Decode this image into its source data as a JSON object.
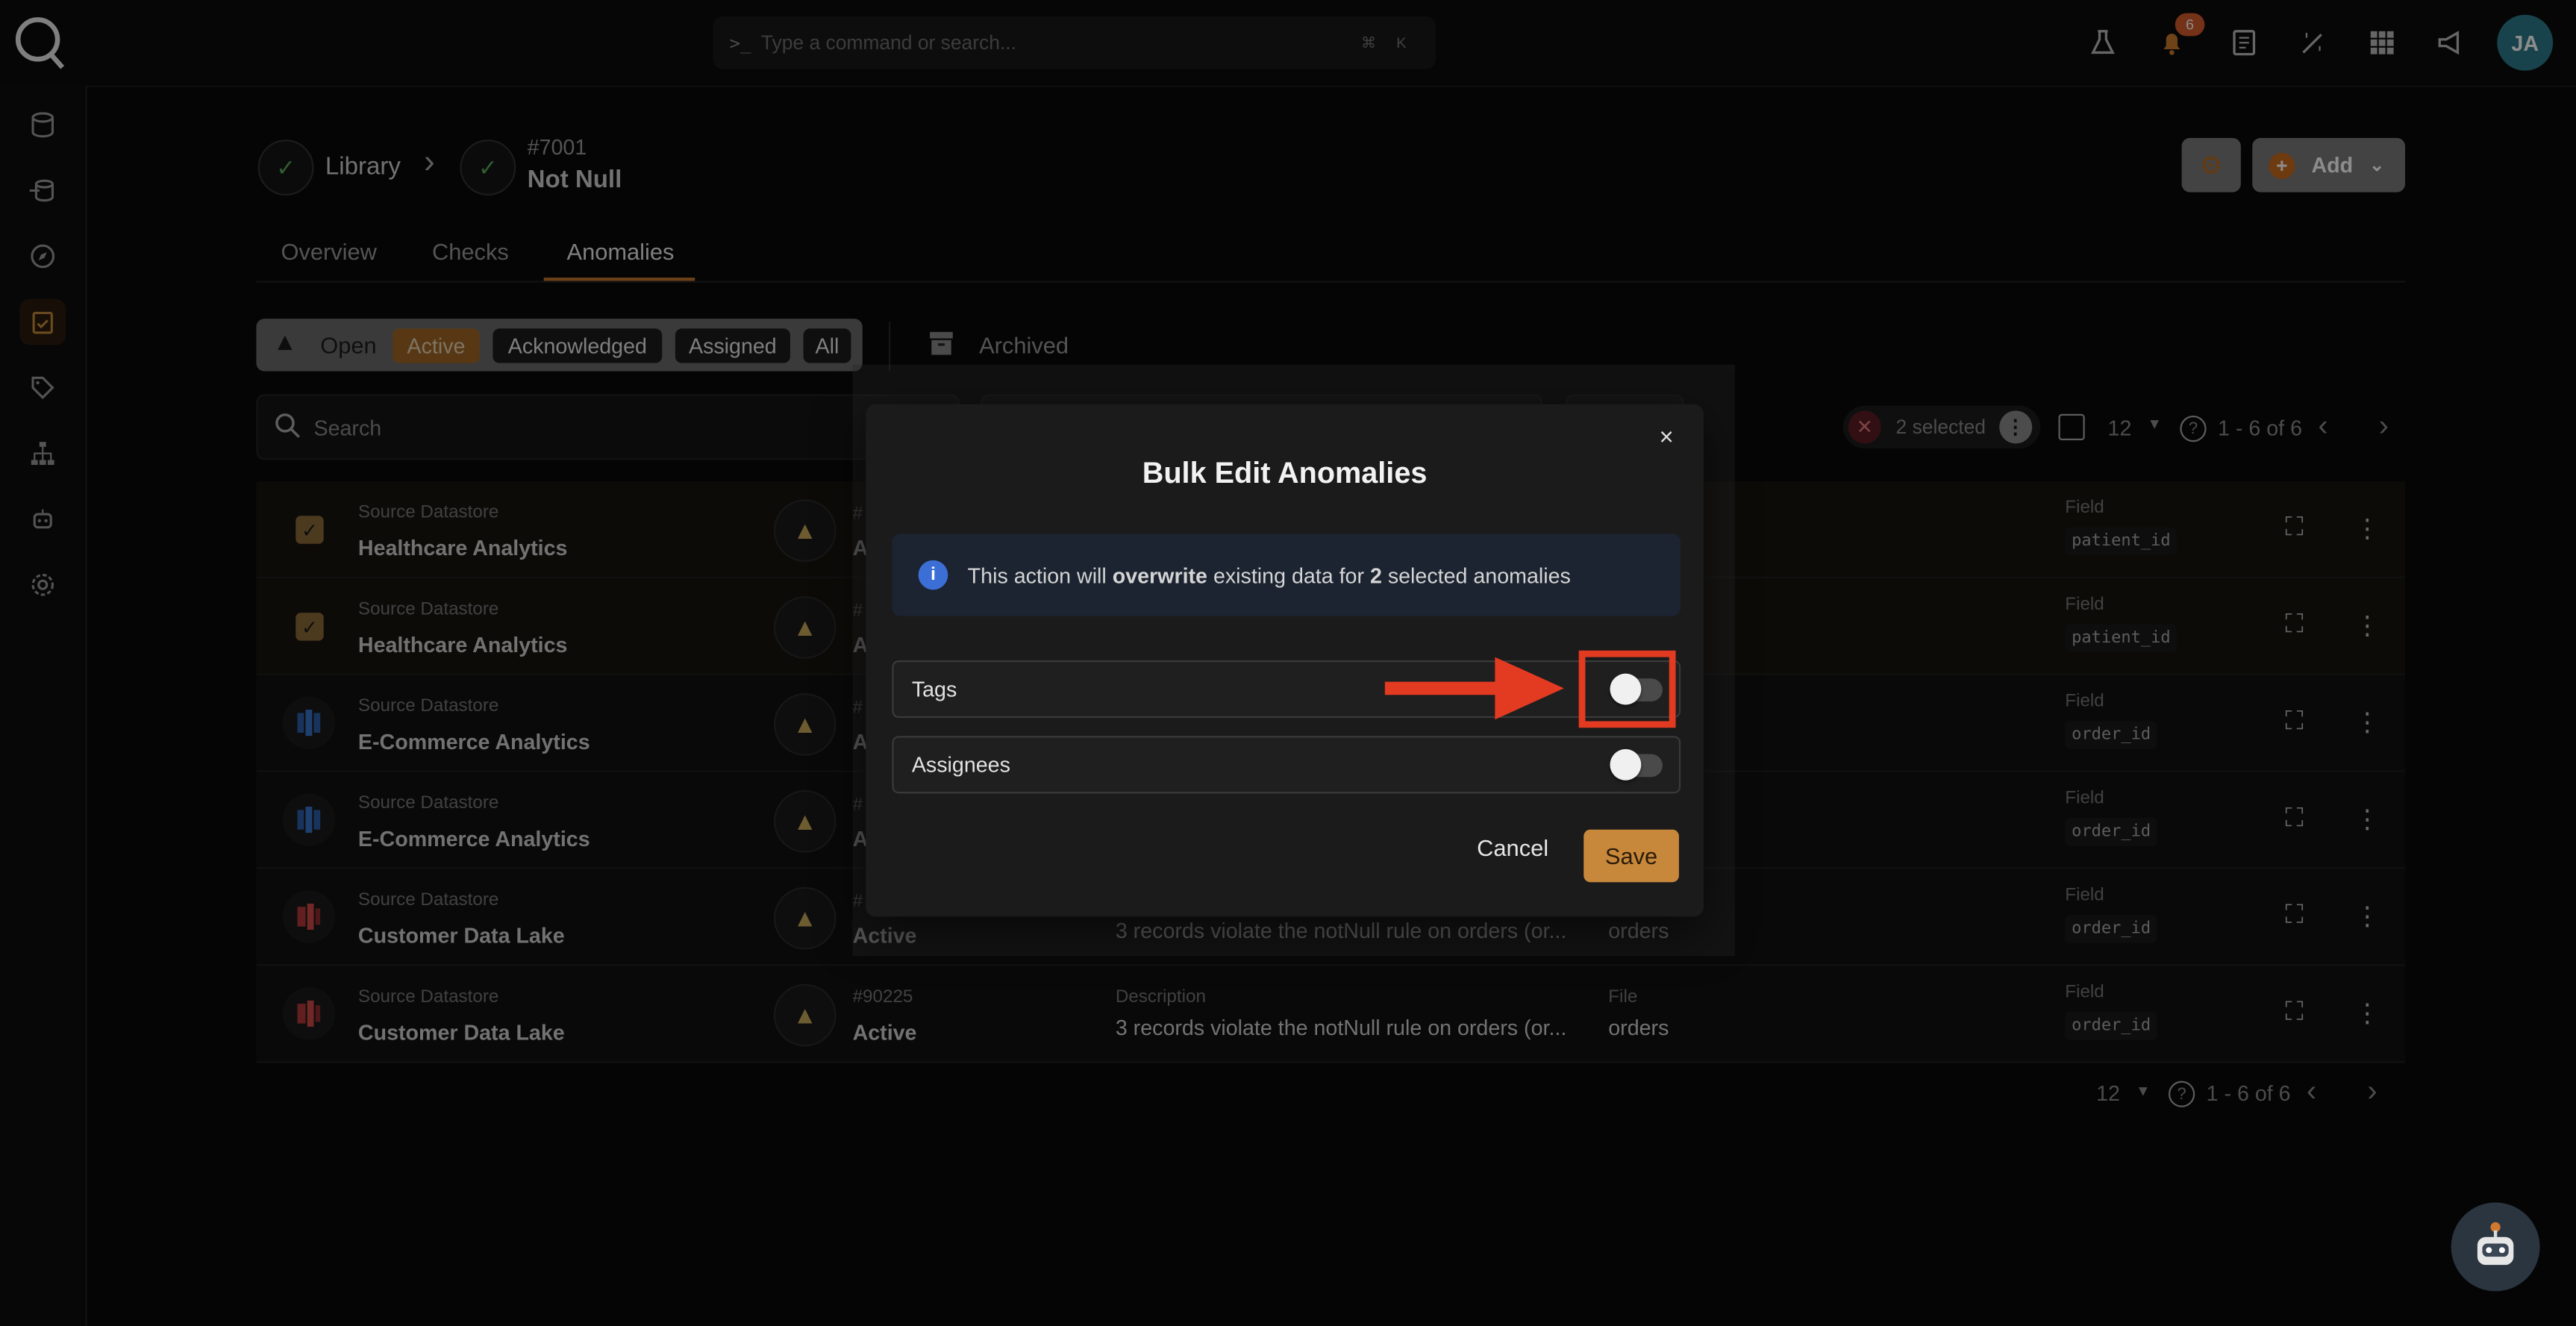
{
  "command": {
    "placeholder": "Type a command or search...",
    "kbd1": "⌘",
    "kbd2": "K"
  },
  "notifications": {
    "count": "6"
  },
  "user": {
    "initials": "JA"
  },
  "breadcrumb": {
    "library": "Library",
    "separator": "›",
    "id": "#7001",
    "title": "Not Null"
  },
  "tabs": [
    {
      "label": "Overview"
    },
    {
      "label": "Checks"
    },
    {
      "label": "Anomalies"
    }
  ],
  "header_actions": {
    "add_label": "Add"
  },
  "filters": {
    "open": "Open",
    "active": "Active",
    "acknowledged": "Acknowledged",
    "assigned": "Assigned",
    "all": "All",
    "archived": "Archived"
  },
  "search": {
    "placeholder": "Search"
  },
  "selection": {
    "text": "2 selected"
  },
  "pagination": {
    "per_page": "12",
    "range": "1 - 6 of 6"
  },
  "rows": [
    {
      "ds_label": "Source Datastore",
      "ds_name": "Healthcare Analytics",
      "id": "#",
      "status": "Ac",
      "field_label": "Field",
      "field": "patient_id"
    },
    {
      "ds_label": "Source Datastore",
      "ds_name": "Healthcare Analytics",
      "id": "#",
      "status": "Ac",
      "field_label": "Field",
      "field": "patient_id"
    },
    {
      "ds_label": "Source Datastore",
      "ds_name": "E-Commerce Analytics",
      "id": "#",
      "status": "Ac",
      "field_label": "Field",
      "field": "order_id"
    },
    {
      "ds_label": "Source Datastore",
      "ds_name": "E-Commerce Analytics",
      "id": "#",
      "status": "Ac",
      "field_label": "Field",
      "field": "order_id"
    },
    {
      "ds_label": "Source Datastore",
      "ds_name": "Customer Data Lake",
      "id": "#",
      "status": "Active",
      "desc": "3 records violate the notNull rule on orders (or...",
      "file": "orders",
      "field_label": "Field",
      "field": "order_id"
    },
    {
      "ds_label": "Source Datastore",
      "ds_name": "Customer Data Lake",
      "id": "#90225",
      "status": "Active",
      "desc_label": "Description",
      "desc": "3 records violate the notNull rule on orders (or...",
      "file_label": "File",
      "file": "orders",
      "field_label": "Field",
      "field": "order_id"
    }
  ],
  "modal": {
    "title": "Bulk Edit Anomalies",
    "close": "×",
    "info_pre": "This action will ",
    "info_bold1": "overwrite",
    "info_mid": " existing data for ",
    "info_bold2": "2",
    "info_post": " selected anomalies",
    "tags_label": "Tags",
    "assignees_label": "Assignees",
    "tags_on": false,
    "assignees_on": false,
    "cancel": "Cancel",
    "save": "Save"
  },
  "colors": {
    "accent": "#c4752e",
    "annotation": "#e33a22",
    "info_icon": "#3c6fd6"
  }
}
